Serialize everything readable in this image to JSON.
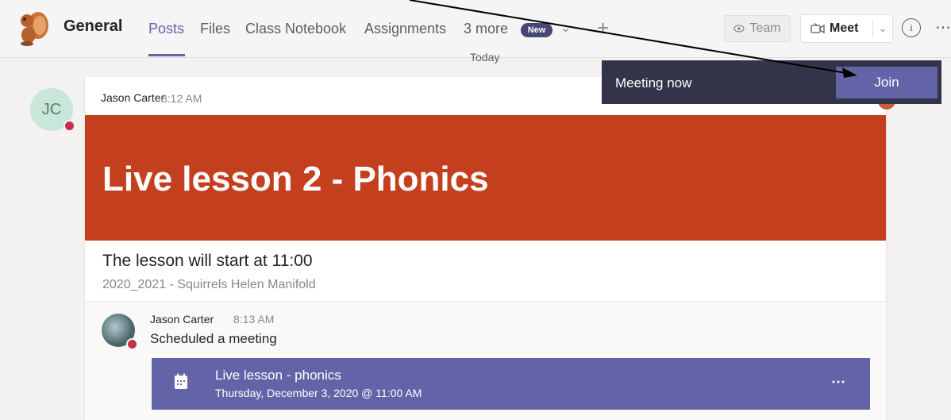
{
  "header": {
    "channel_name": "General",
    "tabs": [
      {
        "label": "Posts",
        "active": true
      },
      {
        "label": "Files"
      },
      {
        "label": "Class Notebook"
      },
      {
        "label": "Assignments"
      },
      {
        "label": "3 more"
      }
    ],
    "new_badge": "New",
    "team_button": "Team",
    "meet_button": "Meet"
  },
  "divider_label": "Today",
  "post": {
    "author_initials": "JC",
    "author": "Jason Carter",
    "time": "8:12 AM",
    "banner_title": "Live lesson 2 - Phonics",
    "subject": "The lesson will start at 11:00",
    "class_name": "2020_2021 - Squirrels Helen Manifold",
    "banner_color": "#c33f1d"
  },
  "reply": {
    "author": "Jason Carter",
    "time": "8:13 AM",
    "text": "Scheduled a meeting",
    "meeting_title": "Live lesson - phonics",
    "meeting_date": "Thursday, December 3, 2020 @ 11:00 AM"
  },
  "toast": {
    "text": "Meeting now",
    "join_label": "Join"
  },
  "colors": {
    "accent": "#6264a7",
    "toast_bg": "#33344a",
    "presence_busy": "#c4314b"
  }
}
